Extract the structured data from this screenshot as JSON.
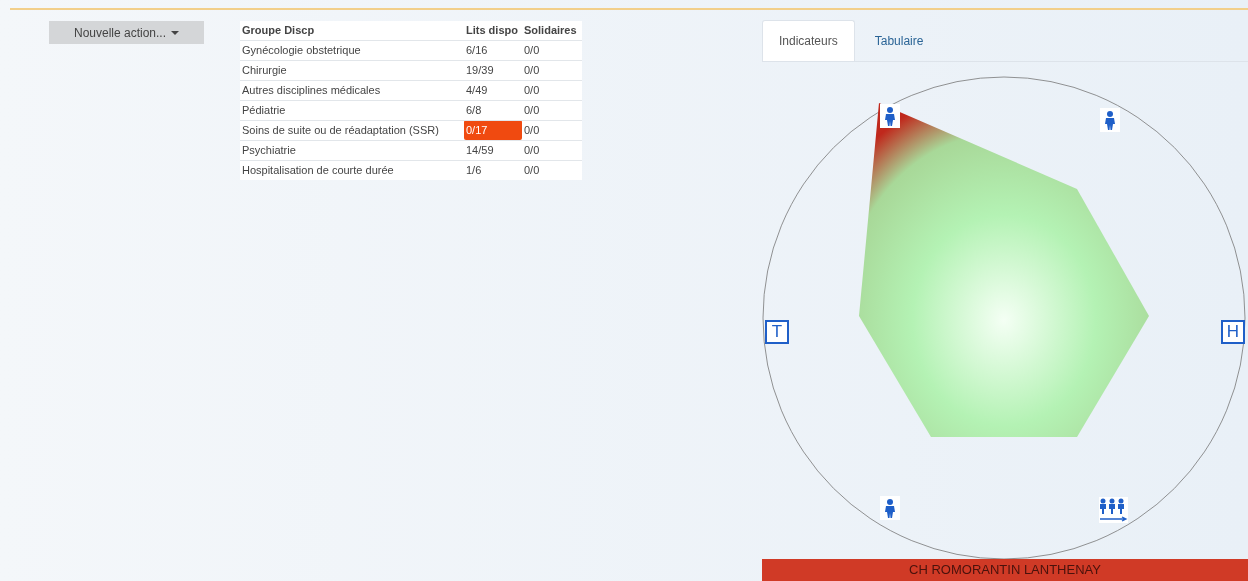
{
  "action_button": {
    "label": "Nouvelle action..."
  },
  "table": {
    "columns": [
      "Groupe Discp",
      "Lits dispo",
      "Solidaires"
    ],
    "rows": [
      {
        "group": "Gynécologie obstetrique",
        "lits_dispo": "6/16",
        "alert": false,
        "solidaires": "0/0"
      },
      {
        "group": "Chirurgie",
        "lits_dispo": "19/39",
        "alert": false,
        "solidaires": "0/0"
      },
      {
        "group": "Autres disciplines médicales",
        "lits_dispo": "4/49",
        "alert": false,
        "solidaires": "0/0"
      },
      {
        "group": "Pédiatrie",
        "lits_dispo": "6/8",
        "alert": false,
        "solidaires": "0/0"
      },
      {
        "group": "Soins de suite ou de réadaptation (SSR)",
        "lits_dispo": "0/17",
        "alert": true,
        "solidaires": "0/0"
      },
      {
        "group": "Psychiatrie",
        "lits_dispo": "14/59",
        "alert": false,
        "solidaires": "0/0"
      },
      {
        "group": "Hospitalisation de courte durée",
        "lits_dispo": "1/6",
        "alert": false,
        "solidaires": "0/0"
      }
    ]
  },
  "tabs": [
    {
      "label": "Indicateurs",
      "selected": true
    },
    {
      "label": "Tabulaire",
      "selected": false
    }
  ],
  "radar": {
    "letter_icons": [
      "T",
      "H"
    ]
  },
  "footer": {
    "title": "CH ROMORANTIN LANTHENAY"
  }
}
